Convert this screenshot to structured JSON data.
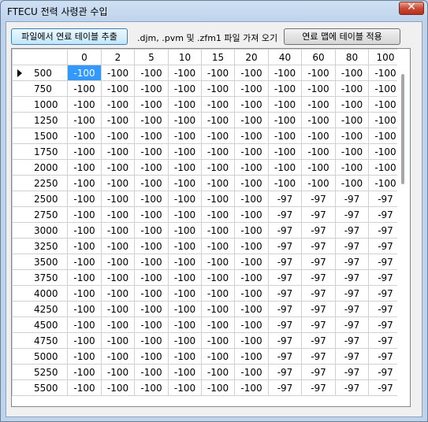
{
  "window": {
    "title": "FTECU 전력 사령관 수입",
    "close_label": "✕"
  },
  "toolbar": {
    "extract_label": "파일에서 연료 테이블 추출",
    "hint": ".djm, .pvm 및 .zfm1 파일 가져 오기",
    "apply_label": "연료 맵에 테이블 적용"
  },
  "table": {
    "columns": [
      "0",
      "2",
      "5",
      "10",
      "15",
      "20",
      "40",
      "60",
      "80",
      "100"
    ],
    "rows": [
      {
        "rpm": "500",
        "values": [
          "-100",
          "-100",
          "-100",
          "-100",
          "-100",
          "-100",
          "-100",
          "-100",
          "-100",
          "-100"
        ]
      },
      {
        "rpm": "750",
        "values": [
          "-100",
          "-100",
          "-100",
          "-100",
          "-100",
          "-100",
          "-100",
          "-100",
          "-100",
          "-100"
        ]
      },
      {
        "rpm": "1000",
        "values": [
          "-100",
          "-100",
          "-100",
          "-100",
          "-100",
          "-100",
          "-100",
          "-100",
          "-100",
          "-100"
        ]
      },
      {
        "rpm": "1250",
        "values": [
          "-100",
          "-100",
          "-100",
          "-100",
          "-100",
          "-100",
          "-100",
          "-100",
          "-100",
          "-100"
        ]
      },
      {
        "rpm": "1500",
        "values": [
          "-100",
          "-100",
          "-100",
          "-100",
          "-100",
          "-100",
          "-100",
          "-100",
          "-100",
          "-100"
        ]
      },
      {
        "rpm": "1750",
        "values": [
          "-100",
          "-100",
          "-100",
          "-100",
          "-100",
          "-100",
          "-100",
          "-100",
          "-100",
          "-100"
        ]
      },
      {
        "rpm": "2000",
        "values": [
          "-100",
          "-100",
          "-100",
          "-100",
          "-100",
          "-100",
          "-100",
          "-100",
          "-100",
          "-100"
        ]
      },
      {
        "rpm": "2250",
        "values": [
          "-100",
          "-100",
          "-100",
          "-100",
          "-100",
          "-100",
          "-100",
          "-100",
          "-100",
          "-100"
        ]
      },
      {
        "rpm": "2500",
        "values": [
          "-100",
          "-100",
          "-100",
          "-100",
          "-100",
          "-100",
          "-97",
          "-97",
          "-97",
          "-97"
        ]
      },
      {
        "rpm": "2750",
        "values": [
          "-100",
          "-100",
          "-100",
          "-100",
          "-100",
          "-100",
          "-97",
          "-97",
          "-97",
          "-97"
        ]
      },
      {
        "rpm": "3000",
        "values": [
          "-100",
          "-100",
          "-100",
          "-100",
          "-100",
          "-100",
          "-97",
          "-97",
          "-97",
          "-97"
        ]
      },
      {
        "rpm": "3250",
        "values": [
          "-100",
          "-100",
          "-100",
          "-100",
          "-100",
          "-100",
          "-97",
          "-97",
          "-97",
          "-97"
        ]
      },
      {
        "rpm": "3500",
        "values": [
          "-100",
          "-100",
          "-100",
          "-100",
          "-100",
          "-100",
          "-97",
          "-97",
          "-97",
          "-97"
        ]
      },
      {
        "rpm": "3750",
        "values": [
          "-100",
          "-100",
          "-100",
          "-100",
          "-100",
          "-100",
          "-97",
          "-97",
          "-97",
          "-97"
        ]
      },
      {
        "rpm": "4000",
        "values": [
          "-100",
          "-100",
          "-100",
          "-100",
          "-100",
          "-100",
          "-97",
          "-97",
          "-97",
          "-97"
        ]
      },
      {
        "rpm": "4250",
        "values": [
          "-100",
          "-100",
          "-100",
          "-100",
          "-100",
          "-100",
          "-97",
          "-97",
          "-97",
          "-97"
        ]
      },
      {
        "rpm": "4500",
        "values": [
          "-100",
          "-100",
          "-100",
          "-100",
          "-100",
          "-100",
          "-97",
          "-97",
          "-97",
          "-97"
        ]
      },
      {
        "rpm": "4750",
        "values": [
          "-100",
          "-100",
          "-100",
          "-100",
          "-100",
          "-100",
          "-97",
          "-97",
          "-97",
          "-97"
        ]
      },
      {
        "rpm": "5000",
        "values": [
          "-100",
          "-100",
          "-100",
          "-100",
          "-100",
          "-100",
          "-97",
          "-97",
          "-97",
          "-97"
        ]
      },
      {
        "rpm": "5250",
        "values": [
          "-100",
          "-100",
          "-100",
          "-100",
          "-100",
          "-100",
          "-97",
          "-97",
          "-97",
          "-97"
        ]
      },
      {
        "rpm": "5500",
        "values": [
          "-100",
          "-100",
          "-100",
          "-100",
          "-100",
          "-100",
          "-97",
          "-97",
          "-97",
          "-97"
        ]
      }
    ],
    "selected": {
      "row": 0,
      "col": 0
    },
    "current_row_marker_row": 0
  },
  "colors": {
    "selection": "#3399ff",
    "close_button": "#c94c34"
  }
}
